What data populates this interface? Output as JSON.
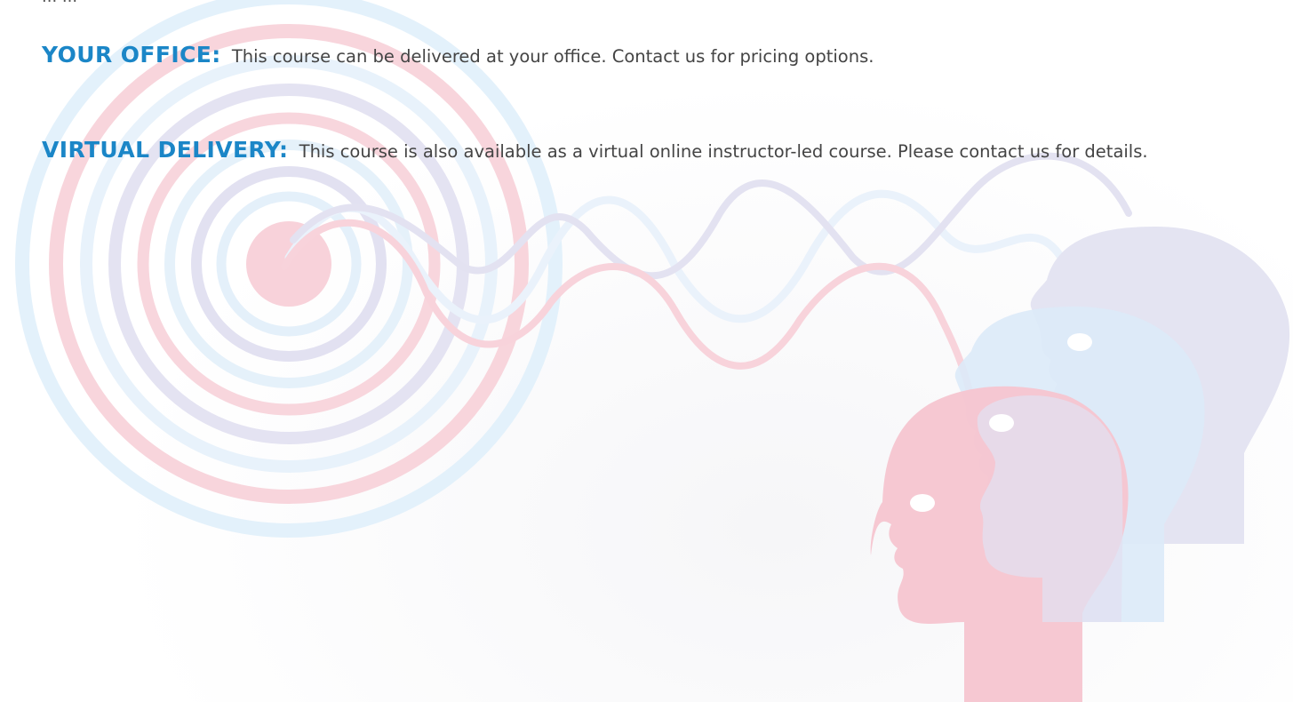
{
  "top_clipped_text": "...                                 ...",
  "sections": {
    "office": {
      "label": "YOUR OFFICE:",
      "text": "This course can be delivered at your office. Contact us for pricing options."
    },
    "virtual": {
      "label": "VIRTUAL DELIVERY:",
      "text": "This course is also available as a virtual online instructor-led course. Please contact us for details."
    }
  },
  "colors": {
    "label_blue": "#1b86c7",
    "body_text": "#444444",
    "pink": "#f6c9d3",
    "lavender": "#dcdcf0",
    "light_blue": "#d6eaf8"
  },
  "illustration": {
    "icon": "sound-wave-heads-illustration"
  }
}
